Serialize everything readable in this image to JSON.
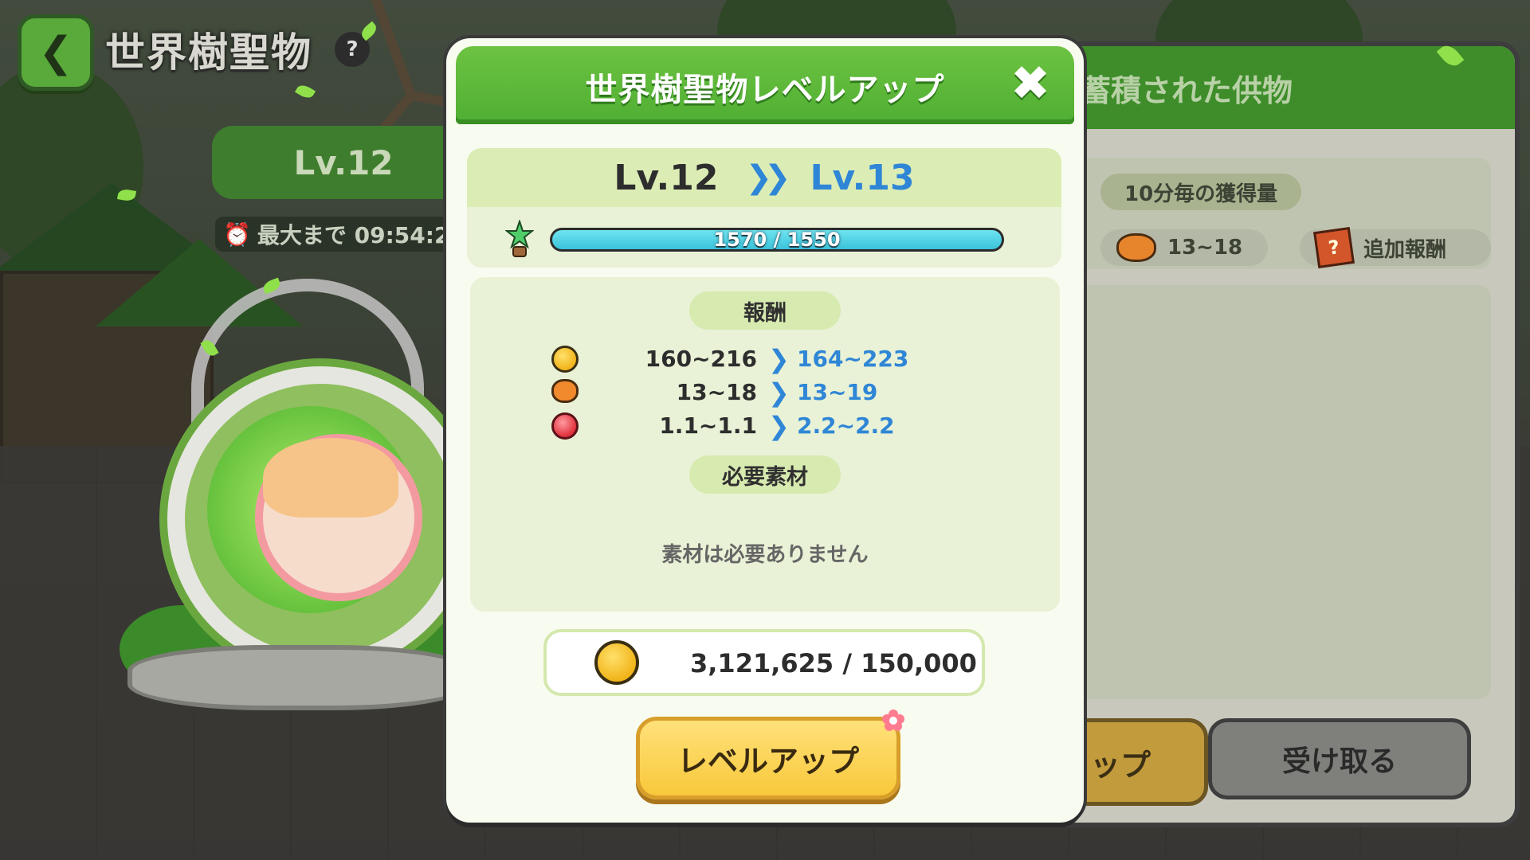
{
  "header": {
    "back_icon": "chevron-left-icon",
    "title": "世界樹聖物",
    "help_label": "?"
  },
  "relic_status": {
    "level": "Lv.12",
    "timer_label": "最大まで 09:54:2",
    "timer_icon": "alarm-clock-icon"
  },
  "background_panel": {
    "title": "蓄積された供物",
    "per_10min_label": "10分毎の獲得量",
    "pancake_amount": "13~18",
    "bonus_label": "追加報酬",
    "levelup_partial": "ップ",
    "receive_label": "受け取る"
  },
  "modal": {
    "title": "世界樹聖物レベルアップ",
    "close_icon": "close-icon",
    "level_from": "Lv.12",
    "level_to": "Lv.13",
    "level_arrow": "»",
    "xp_text": "1570 / 1550",
    "xp_fraction": 1.0,
    "reward_label": "報酬",
    "rewards": [
      {
        "icon": "coin-icon",
        "from": "160~216",
        "to": "164~223"
      },
      {
        "icon": "pancake-icon",
        "from": "13~18",
        "to": "13~19"
      },
      {
        "icon": "jelly-icon",
        "from": "1.1~1.1",
        "to": "2.2~2.2"
      }
    ],
    "required_label": "必要素材",
    "no_material_text": "素材は必要ありません",
    "cost_text": "3,121,625 / 150,000",
    "levelup_button": "レベルアップ"
  },
  "colors": {
    "accent_green": "#4fae33",
    "level_blue": "#2f86d6",
    "button_yellow": "#f8c83a"
  }
}
